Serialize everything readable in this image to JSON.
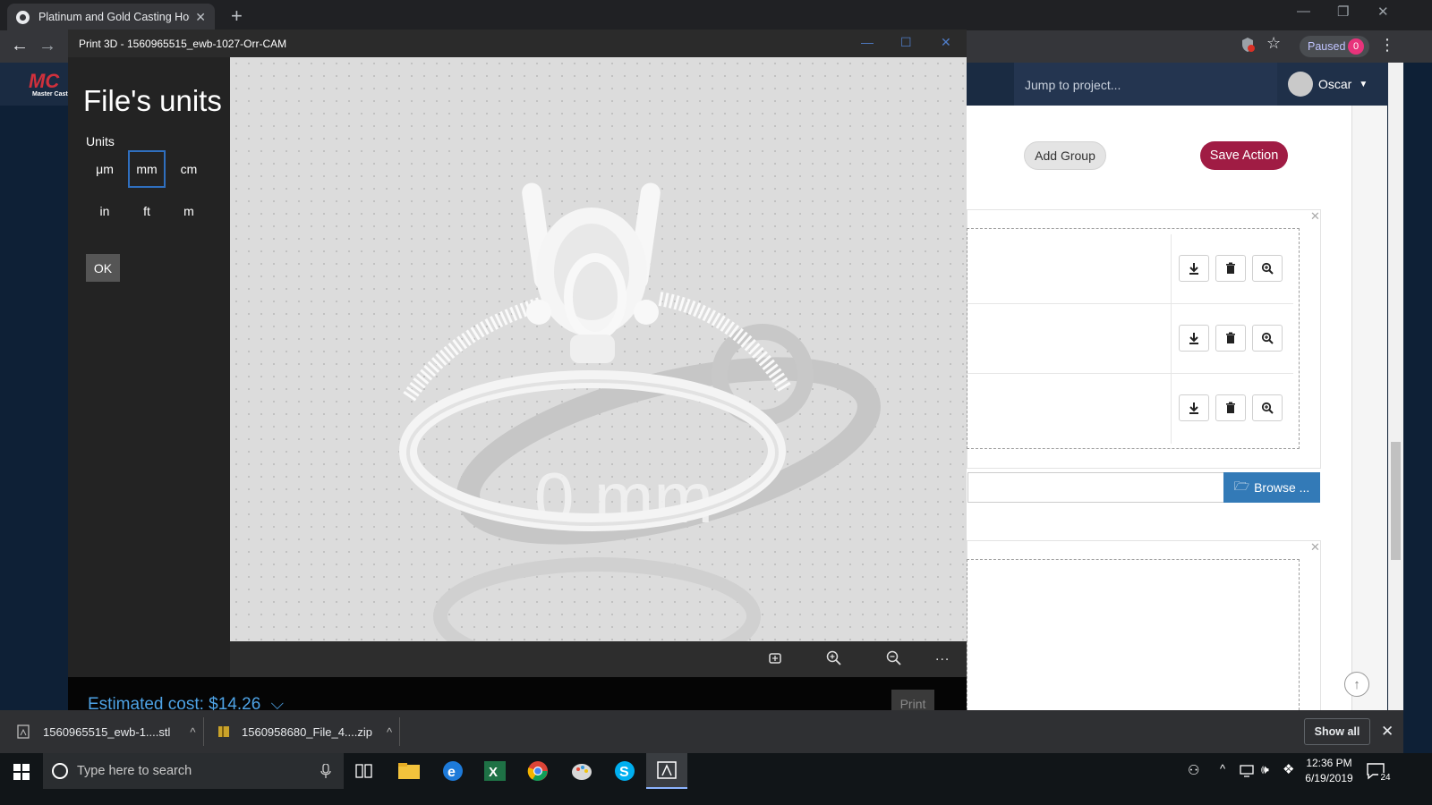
{
  "browser": {
    "tab_title": "Platinum and Gold Casting House",
    "tab_close": "✕",
    "new_tab": "+",
    "paused_label": "Paused",
    "paused_count": "0"
  },
  "site": {
    "logo_letters": "MC",
    "logo_small": "Master Cast",
    "jump_placeholder": "Jump to project...",
    "user_name": "Oscar",
    "add_group_label": "Add Group",
    "save_action_label": "Save Action",
    "browse_label": "Browse ...",
    "panel_close": "✕"
  },
  "print3d": {
    "window_title": "Print 3D - 1560965515_ewb-1027-Orr-CAM",
    "heading": "File's units",
    "units_label": "Units",
    "units": [
      "μm",
      "mm",
      "cm",
      "in",
      "ft",
      "m"
    ],
    "selected_unit": "mm",
    "ok_label": "OK",
    "viewport_watermark": "0 mm",
    "estimated_cost": "Estimated cost: $14.26",
    "print_label": "Print",
    "more_label": "..."
  },
  "downloads": {
    "items": [
      "1560965515_ewb-1....stl",
      "1560958680_File_4....zip"
    ],
    "show_all_label": "Show all",
    "close": "✕"
  },
  "taskbar": {
    "search_placeholder": "Type here to search",
    "time": "12:36 PM",
    "date": "6/19/2019",
    "notification_count": "24"
  }
}
